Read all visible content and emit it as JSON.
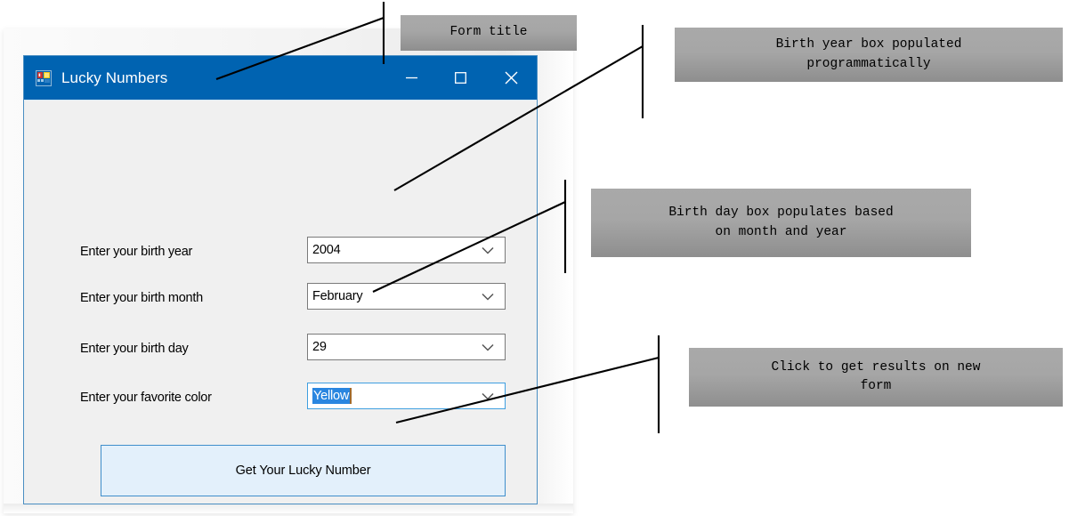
{
  "window": {
    "title": "Lucky Numbers",
    "icon": "winforms-app-icon",
    "caption": {
      "minimize_label": "—",
      "maximize_label": "☐",
      "close_label": "✕"
    }
  },
  "form": {
    "fields": [
      {
        "label": "Enter your birth year",
        "value": "2004",
        "name": "birth-year",
        "focused": false,
        "selected": false
      },
      {
        "label": "Enter your birth month",
        "value": "February",
        "name": "birth-month",
        "focused": false,
        "selected": false
      },
      {
        "label": "Enter your birth day",
        "value": "29",
        "name": "birth-day",
        "focused": false,
        "selected": false
      },
      {
        "label": "Enter your favorite color",
        "value": "Yellow",
        "name": "favorite-color",
        "focused": true,
        "selected": true
      }
    ],
    "submit_button": "Get Your Lucky Number"
  },
  "annotations": [
    {
      "text": "Form title",
      "name": "callout-form-title"
    },
    {
      "text": "Birth year box populated\nprogrammatically",
      "name": "callout-birth-year"
    },
    {
      "text": "Birth day box populates based\non month and year",
      "name": "callout-birth-day"
    },
    {
      "text": "Click to get results on new\nform",
      "name": "callout-submit"
    }
  ],
  "colors": {
    "titlebar": "#0063b1",
    "form_background": "#f0f0f0",
    "window_border": "#4a8ec2",
    "button_fill": "#e3f0fb",
    "button_border": "#3f8ecb",
    "selection_highlight": "#2a86e0",
    "callout_fill": "#a6a6a6",
    "leader_line": "#000000"
  }
}
